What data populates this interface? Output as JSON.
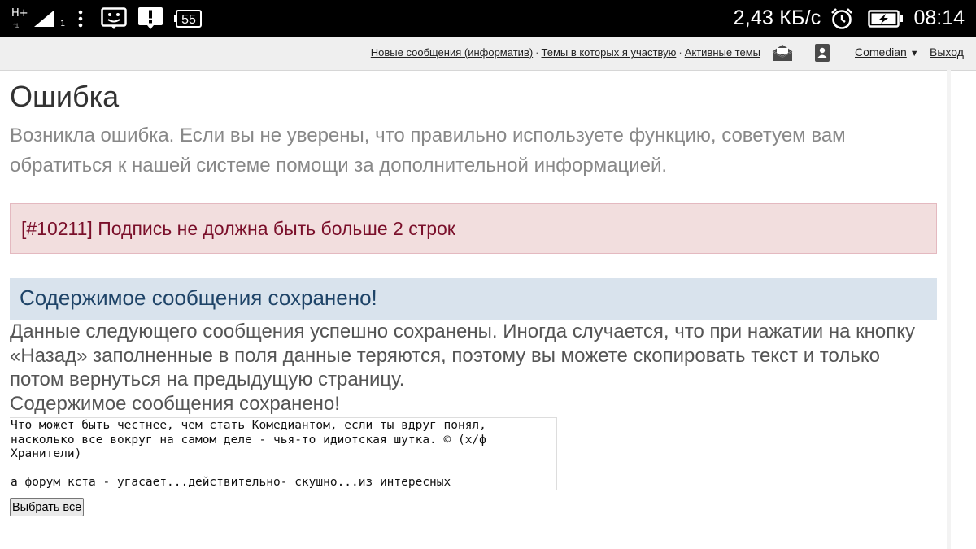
{
  "status_bar": {
    "network_type": "H+",
    "sim_index": "1",
    "battery_badge": "55",
    "speed": "2,43 КБ/с",
    "time": "08:14",
    "icons": [
      "signal-icon",
      "overflow-menu-icon",
      "face-notification-icon",
      "alert-notification-icon",
      "battery-badge-icon",
      "alarm-icon",
      "battery-charging-icon"
    ]
  },
  "nav": {
    "links": [
      {
        "label": "Новые сообщения (информатив)"
      },
      {
        "label": "Темы в которых я участвую"
      },
      {
        "label": "Активные темы"
      }
    ],
    "separator": "·",
    "icons": [
      "envelope-open-icon",
      "contact-book-icon"
    ],
    "user": "Comedian",
    "logout": "Выход"
  },
  "error": {
    "title": "Ошибка",
    "description": "Возникла ошибка. Если вы не уверены, что правильно используете функцию, советуем вам обратиться к нашей системе помощи за дополнительной информацией.",
    "message": "[#10211] Подпись не должна быть больше 2 строк"
  },
  "saved_panel": {
    "title": "Содержимое сообщения сохранено!",
    "body": "Данные следующего сообщения успешно сохранены. Иногда случается, что при нажатии на кнопку «Назад» заполненные в поля данные теряются, поэтому вы можете скопировать текст и только потом вернуться на предыдущую страницу.",
    "subtitle": "Содержимое сообщения сохранено!",
    "saved_text": "Что может быть честнее, чем стать Комедиантом, если ты вдруг понял,\nнасколько все вокруг на самом деле - чья-то идиотская шутка. © (х/ф\nХранители)\n\nа форум кста - угасает...действительно- скушно...из интересных",
    "select_all_label": "Выбрать все"
  },
  "colors": {
    "alert_background": "#f2dede",
    "alert_text": "#7a0f2a",
    "panel_header_background": "#d9e3ed",
    "panel_header_text": "#1f4468"
  }
}
